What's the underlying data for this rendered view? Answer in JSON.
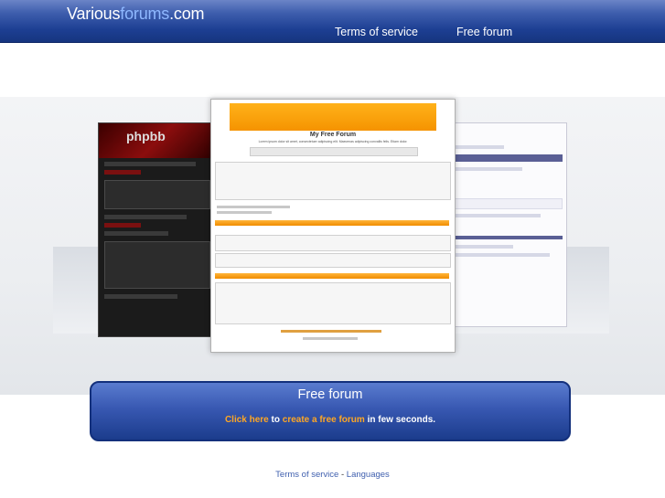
{
  "header": {
    "logo_part1": "Various",
    "logo_part2": "forums",
    "logo_part3": ".com",
    "nav": [
      "Terms of service",
      "Free forum"
    ]
  },
  "preview": {
    "forum_title": "My Free Forum",
    "forum_subtitle": "Lorem ipsum dolor sit amet, consectetuer adipiscing elit. Maecenas adipiscing convallis felis. Etiam dolor."
  },
  "cta": {
    "title": "Free forum",
    "click_here": "Click here",
    "to": "to",
    "create_link": "create a free forum",
    "suffix": "in few seconds."
  },
  "footer": {
    "terms": "Terms of service",
    "separator": "-",
    "languages": "Languages"
  },
  "colors": {
    "header_blue": "#1d3f93",
    "cta_highlight": "#ffa724",
    "link_blue": "#3f5fae"
  }
}
